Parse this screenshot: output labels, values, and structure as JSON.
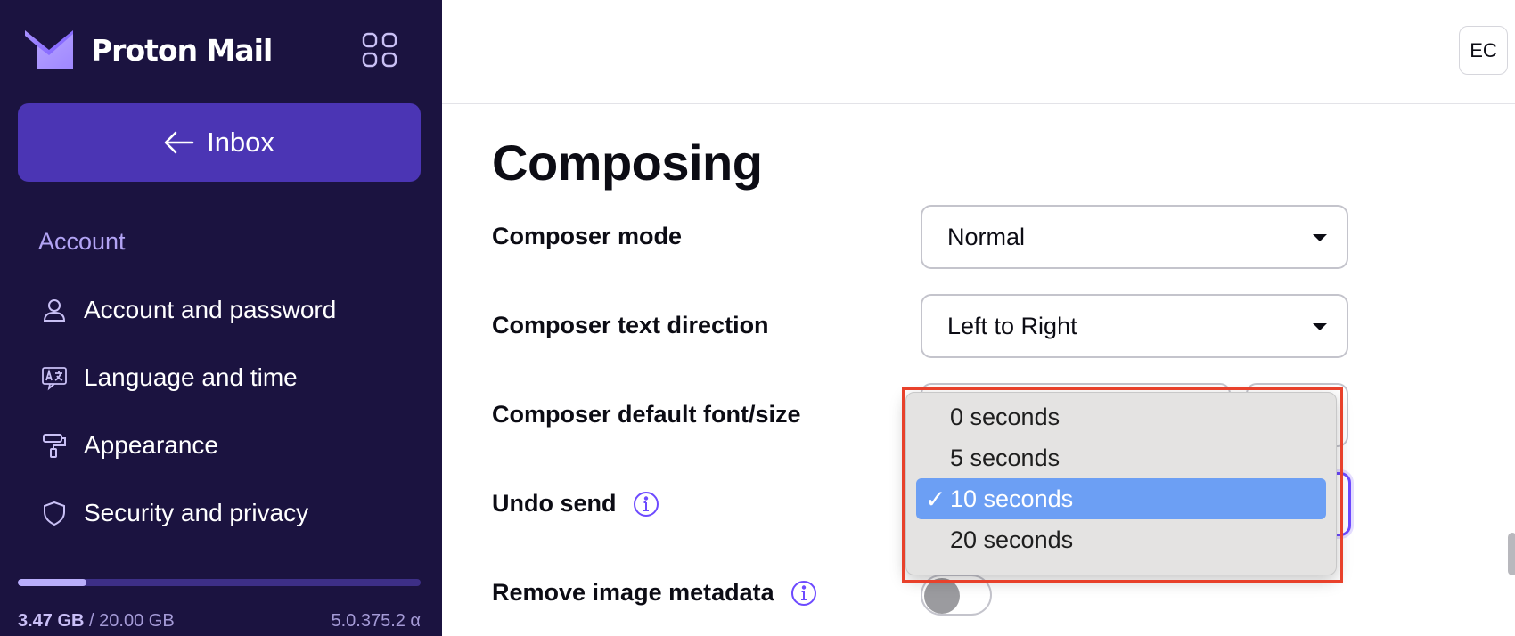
{
  "brand": {
    "name": "Proton Mail",
    "logo_color": "#8b6cff"
  },
  "sidebar": {
    "inbox_label": "Inbox",
    "section": "Account",
    "items": [
      {
        "label": "Account and password",
        "icon": "user-icon"
      },
      {
        "label": "Language and time",
        "icon": "language-icon"
      },
      {
        "label": "Appearance",
        "icon": "paint-roller-icon"
      },
      {
        "label": "Security and privacy",
        "icon": "shield-icon"
      }
    ],
    "storage": {
      "used": "3.47 GB",
      "total": "/ 20.00 GB",
      "fraction": 0.17
    },
    "version": "5.0.375.2 α"
  },
  "header": {
    "avatar_initials": "EC"
  },
  "main": {
    "title": "Composing",
    "rows": [
      {
        "label": "Composer mode",
        "value": "Normal"
      },
      {
        "label": "Composer text direction",
        "value": "Left to Right"
      },
      {
        "label": "Composer default font/size"
      },
      {
        "label": "Undo send"
      },
      {
        "label": "Remove image metadata"
      }
    ]
  },
  "dropdown": {
    "options": [
      "0 seconds",
      "5 seconds",
      "10 seconds",
      "20 seconds"
    ],
    "selected_index": 2,
    "check": "✓"
  },
  "colors": {
    "sidebar_bg": "#1b1340",
    "primary": "#4b35b4",
    "accent": "#6d4aff",
    "selection": "#6c9ff4",
    "annotation": "#e8412b"
  }
}
